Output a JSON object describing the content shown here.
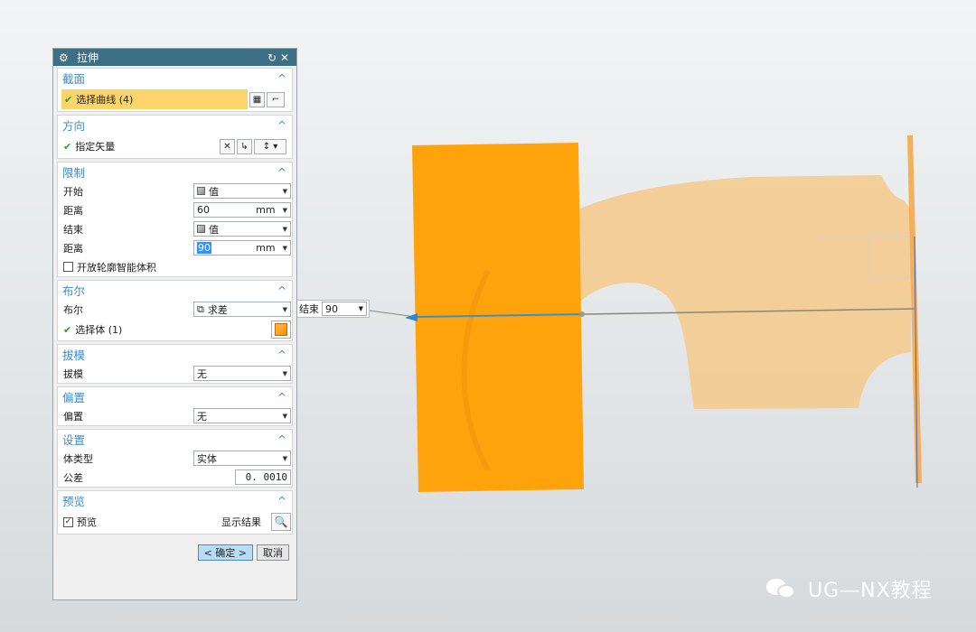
{
  "dialog": {
    "title": "拉伸",
    "sections": {
      "section": {
        "title": "截面",
        "select_curve": "选择曲线 (4)"
      },
      "direction": {
        "title": "方向",
        "vector": "指定矢量"
      },
      "limits": {
        "title": "限制",
        "start_label": "开始",
        "start_value": "值",
        "start_dist_label": "距离",
        "start_dist": "60",
        "start_unit": "mm",
        "end_label": "结束",
        "end_value": "值",
        "end_dist_label": "距离",
        "end_dist": "90",
        "end_unit": "mm",
        "open_profile": "开放轮廓智能体积"
      },
      "boolean": {
        "title": "布尔",
        "label": "布尔",
        "value": "求差",
        "select_body": "选择体 (1)"
      },
      "draft": {
        "title": "拔模",
        "label": "拔模",
        "value": "无"
      },
      "offset": {
        "title": "偏置",
        "label": "偏置",
        "value": "无"
      },
      "settings": {
        "title": "设置",
        "body_type_label": "体类型",
        "body_type": "实体",
        "tolerance_label": "公差",
        "tolerance": "0. 0010"
      },
      "preview": {
        "title": "预览",
        "preview_label": "预览",
        "preview_checked": true,
        "show_result": "显示结果"
      }
    },
    "ok": "< 确定 >",
    "cancel": "取消"
  },
  "floating": {
    "label": "结束",
    "value": "90"
  },
  "watermark": "UG—NX教程",
  "colors": {
    "accent": "#3a8bd0",
    "title_bar": "#3d6f87",
    "selection": "#fbd46b",
    "solid_orange": "#ffa500",
    "body_tan": "#f5c98a"
  }
}
